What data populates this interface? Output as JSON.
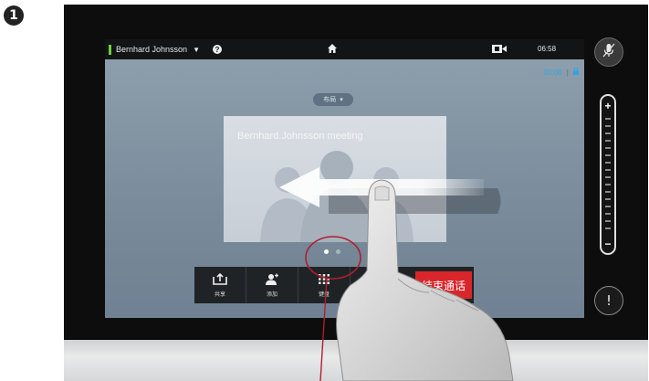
{
  "step_badge": "1",
  "topbar": {
    "participant_name": "Bernhard Johnsson",
    "help_label": "?",
    "clock": "06:58"
  },
  "call": {
    "timer": "00:08",
    "layout_label": "布局"
  },
  "meeting_card": {
    "title": "Bernhard.Johnsson meeting"
  },
  "pagination": {
    "pages": 2,
    "current": 1
  },
  "controls": [
    {
      "label": "共享",
      "icon": "share-icon"
    },
    {
      "label": "添加",
      "icon": "add-participant-icon"
    },
    {
      "label": "键盘",
      "icon": "keypad-icon"
    }
  ],
  "end_call_label": "结束通话",
  "side_panel": {
    "volume_plus": "+",
    "volume_minus": "−",
    "alert_label": "!"
  },
  "colors": {
    "status_indicator": "#6ed03a",
    "timer": "#2ba6e8",
    "end_call": "#d9262b",
    "callout_line": "#b01d2e"
  }
}
